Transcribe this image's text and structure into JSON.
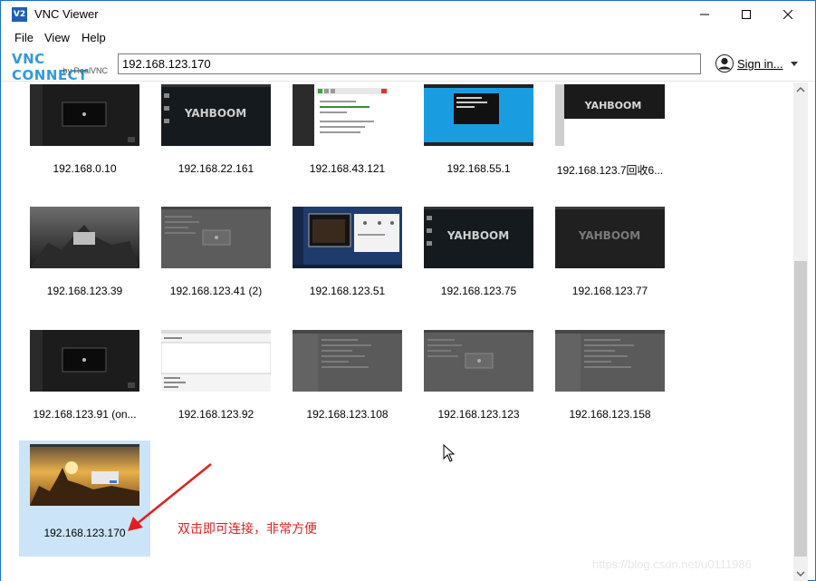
{
  "window": {
    "title": "VNC Viewer",
    "icon_text": "V2",
    "controls": [
      "minimize-icon",
      "maximize-icon",
      "close-icon"
    ]
  },
  "menu": [
    "File",
    "View",
    "Help"
  ],
  "toolbar": {
    "logo_main": "VNC CONNECT",
    "logo_sub": "by RealVNC",
    "address_value": "192.168.123.170",
    "sign_in_label": "Sign in..."
  },
  "tiles": [
    {
      "label": "192.168.0.10",
      "theme": "dark-window"
    },
    {
      "label": "192.168.22.161",
      "theme": "yahboom"
    },
    {
      "label": "192.168.43.121",
      "theme": "ide"
    },
    {
      "label": "192.168.55.1",
      "theme": "blue-desktop"
    },
    {
      "label": "192.168.123.7回收6...",
      "theme": "yahboom-white"
    },
    {
      "label": "192.168.123.39",
      "theme": "grey-photo"
    },
    {
      "label": "192.168.123.41  (2)",
      "theme": "grey-dialog"
    },
    {
      "label": "192.168.123.51",
      "theme": "blue-windows"
    },
    {
      "label": "192.168.123.75",
      "theme": "yahboom"
    },
    {
      "label": "192.168.123.77",
      "theme": "yahboom-dark"
    },
    {
      "label": "192.168.123.91 (on...",
      "theme": "dark-window"
    },
    {
      "label": "192.168.123.92",
      "theme": "white-editor"
    },
    {
      "label": "192.168.123.108",
      "theme": "grey-editor"
    },
    {
      "label": "192.168.123.123",
      "theme": "grey-dialog"
    },
    {
      "label": "192.168.123.158",
      "theme": "grey-editor"
    },
    {
      "label": "192.168.123.170",
      "theme": "sunset",
      "selected": true
    }
  ],
  "annotation": "双击即可连接，非常方便",
  "watermark": "https://blog.csdn.net/u0111986",
  "colors": {
    "accent": "#1a6fd0",
    "selection": "#cce4f7",
    "annotation": "#e02020",
    "logo": "#2f9be0"
  }
}
